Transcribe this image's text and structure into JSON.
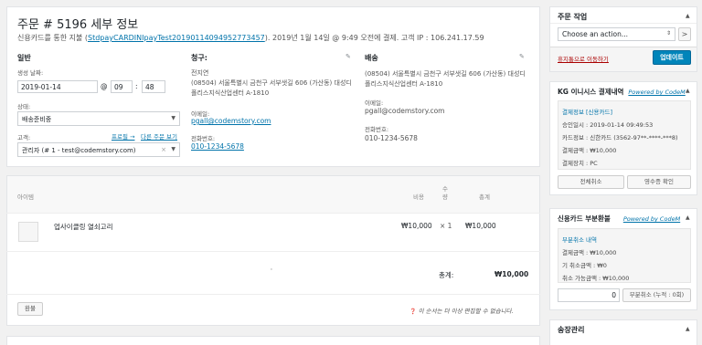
{
  "order": {
    "title": "주문 # 5196 세부 정보",
    "meta_prefix": "신용카드를 통한 지불 (",
    "meta_link": "StdpayCARDINIpayTest20190114094952773457",
    "meta_suffix": "). 2019년 1월 14일 @ 9:49 오전에 결제. 고객 IP : 106.241.17.59"
  },
  "general": {
    "heading": "일반",
    "date_label": "생성 날짜:",
    "date_value": "2019-01-14",
    "at_sign": "@",
    "hour": "09",
    "minute": "48",
    "time_sep": ":",
    "status_label": "상태:",
    "status_value": "배송준비중",
    "customer_label": "고객:",
    "profile_link": "프로필 →",
    "other_orders_link": "다른 주문 보기",
    "customer_value": "관리자 (# 1 - test@codemstory.com)",
    "clear_x": "×"
  },
  "billing": {
    "heading": "청구:",
    "name": "전지연",
    "address1": "(08504) 서울특별시 금천구 서부샛길 606 (가산동) 대성디",
    "address2": "폴리스지식산업센터 A-1810",
    "email_label": "이메일:",
    "email": "pgall@codemstory.com",
    "phone_label": "전화번호:",
    "phone": "010-1234-5678"
  },
  "shipping": {
    "heading": "배송",
    "address1": "(08504) 서울특별시 금천구 서부샛길 606 (가산동) 대성디",
    "address2": "폴리스지식산업센터 A-1810",
    "email_label": "이메일:",
    "email": "pgall@codemstory.com",
    "phone_label": "전화번호:",
    "phone": "010-1234-5678"
  },
  "items": {
    "col_item": "아이템",
    "col_cost": "비용",
    "col_qty": "수량",
    "col_total": "총계",
    "row": {
      "name": "업사이클링 열쇠고리",
      "cost": "₩10,000",
      "qty": "× 1",
      "total": "₩10,000"
    },
    "total_label": "총계:",
    "total_value": "₩10,000",
    "dot": "'",
    "refund_button": "환불",
    "note": "이 순서는 더 이상 편집할 수 없습니다."
  },
  "order_actions": {
    "heading": "주문 작업",
    "select_value": "Choose an action...",
    "go_button": ">",
    "trash_link": "휴지통으로 이동하기",
    "update_button": "업데이트"
  },
  "kg_payment": {
    "heading": "KG 이니시스 결제내역",
    "powered": "Powered by CodeM",
    "section_title": "결제정보 [신용카드]",
    "approved_at": "승인일시 : 2019-01-14 09:49:53",
    "card_info": "카드정보 : 신한카드 (3562-97**-****-***8)",
    "amount": "결제금액 : ₩10,000",
    "device": "결제장치 : PC",
    "cancel_all_button": "전체취소",
    "receipt_button": "영수증 확인"
  },
  "partial_refund": {
    "heading": "신용카드 부분환불",
    "powered": "Powered by CodeM",
    "section_title": "부분취소 내역",
    "amount": "결제금액 : ₩10,000",
    "already_cancelled": "기 취소금액 : ₩0",
    "cancellable": "취소 가능금액 : ₩10,000",
    "input_value": "0",
    "partial_button": "부분취소 (누적 : 0회)"
  },
  "invoice": {
    "heading": "송장관리"
  },
  "icons": {
    "pencil": "✎",
    "caret_up": "▲",
    "caret_down": "▼",
    "info": "❓"
  }
}
